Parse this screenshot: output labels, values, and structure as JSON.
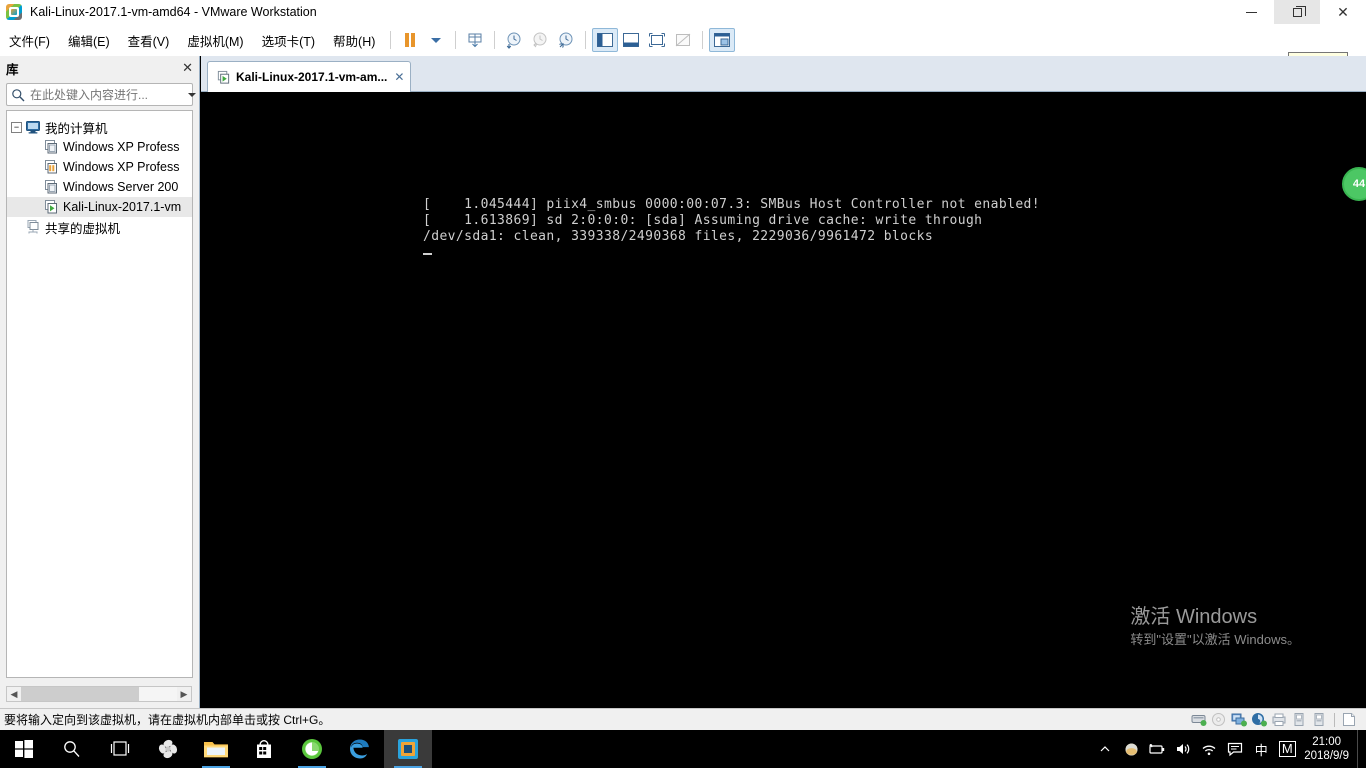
{
  "window": {
    "title": "Kali-Linux-2017.1-vm-amd64 - VMware Workstation",
    "logo_icon": "vmware-logo-icon",
    "minimize_icon": "minimize-icon",
    "restore_icon": "restore-down-icon",
    "close_icon": "close-icon",
    "restore_tooltip": "向下还原"
  },
  "menu": {
    "items": [
      {
        "label": "文件(F)"
      },
      {
        "label": "编辑(E)"
      },
      {
        "label": "查看(V)"
      },
      {
        "label": "虚拟机(M)"
      },
      {
        "label": "选项卡(T)"
      },
      {
        "label": "帮助(H)"
      }
    ]
  },
  "toolbar": {
    "icons": [
      {
        "name": "pause-icon",
        "title": "暂停"
      },
      {
        "name": "chevron-down-icon",
        "title": "更多"
      },
      {
        "name": "send-ctrl-alt-del-icon",
        "title": "发送 Ctrl+Alt+Del"
      },
      {
        "name": "take-snapshot-icon",
        "title": "拍摄快照"
      },
      {
        "name": "revert-snapshot-icon",
        "title": "恢复快照"
      },
      {
        "name": "snapshot-manager-icon",
        "title": "快照管理器"
      },
      {
        "name": "show-library-icon",
        "title": "显示或隐藏库"
      },
      {
        "name": "show-thumbnail-bar-icon",
        "title": "显示或隐藏缩略图栏"
      },
      {
        "name": "fullscreen-icon",
        "title": "进入全屏模式"
      },
      {
        "name": "unity-mode-icon",
        "title": "进入 Unity 模式"
      },
      {
        "name": "console-view-icon",
        "title": "控制台视图"
      }
    ]
  },
  "sidebar": {
    "title": "库",
    "close_icon": "close-icon",
    "search": {
      "icon": "search-icon",
      "placeholder": "在此处键入内容进行...",
      "value": "",
      "dropdown_icon": "chevron-down-icon"
    },
    "tree": [
      {
        "label": "我的计算机",
        "icon": "my-computer-icon",
        "level": 0,
        "expanded": true,
        "selected": false
      },
      {
        "label": "Windows XP Profess",
        "icon": "vm-icon",
        "level": 1,
        "selected": false
      },
      {
        "label": "Windows XP Profess",
        "icon": "vm-suspended-icon",
        "level": 1,
        "selected": false
      },
      {
        "label": "Windows Server 200",
        "icon": "vm-icon",
        "level": 1,
        "selected": false
      },
      {
        "label": "Kali-Linux-2017.1-vm",
        "icon": "vm-running-icon",
        "level": 1,
        "selected": true
      },
      {
        "label": "共享的虚拟机",
        "icon": "shared-vms-icon",
        "level": 0,
        "selected": false
      }
    ],
    "scroll_left_icon": "chevron-left-icon",
    "scroll_right_icon": "chevron-right-icon"
  },
  "tabs": [
    {
      "label": "Kali-Linux-2017.1-vm-am...",
      "icon": "vm-running-icon",
      "close_icon": "close-icon",
      "active": true
    }
  ],
  "console": {
    "lines": [
      "[    1.045444] piix4_smbus 0000:00:07.3: SMBus Host Controller not enabled!",
      "[    1.613869] sd 2:0:0:0: [sda] Assuming drive cache: write through",
      "/dev/sda1: clean, 339338/2490368 files, 2229036/9961472 blocks"
    ],
    "cursor": "_",
    "background": "#000000",
    "text_color": "#cfcfcf"
  },
  "watermark": {
    "title": "激活 Windows",
    "subtitle": "转到\"设置\"以激活 Windows。"
  },
  "notification_badge": {
    "label": "44",
    "color": "#4cc764"
  },
  "statusbar": {
    "message": "要将输入定向到该虚拟机，请在虚拟机内部单击或按 Ctrl+G。",
    "devices": [
      {
        "name": "hard-disk-icon"
      },
      {
        "name": "cd-dvd-icon"
      },
      {
        "name": "network-adapter-icon"
      },
      {
        "name": "sound-card-icon"
      },
      {
        "name": "printer-icon"
      },
      {
        "name": "usb-device-icon"
      },
      {
        "name": "usb-device-icon"
      },
      {
        "name": "shared-folder-icon"
      }
    ]
  },
  "taskbar": {
    "items": [
      {
        "name": "start-button-icon"
      },
      {
        "name": "search-icon"
      },
      {
        "name": "task-view-icon"
      },
      {
        "name": "pinwheel-app-icon"
      },
      {
        "name": "file-explorer-icon",
        "running": true
      },
      {
        "name": "microsoft-store-icon"
      },
      {
        "name": "green-browser-icon",
        "running": true
      },
      {
        "name": "edge-browser-icon"
      },
      {
        "name": "vmware-workstation-icon",
        "active": true,
        "running": true
      }
    ],
    "tray": {
      "expand_icon": "chevron-up-icon",
      "icons": [
        {
          "name": "onedrive-cloud-icon"
        },
        {
          "name": "battery-icon"
        },
        {
          "name": "volume-icon"
        },
        {
          "name": "wifi-icon"
        },
        {
          "name": "action-center-icon"
        }
      ],
      "ime_label": "中",
      "ime_mode_label": "M",
      "time": "21:00",
      "date": "2018/9/9"
    }
  }
}
